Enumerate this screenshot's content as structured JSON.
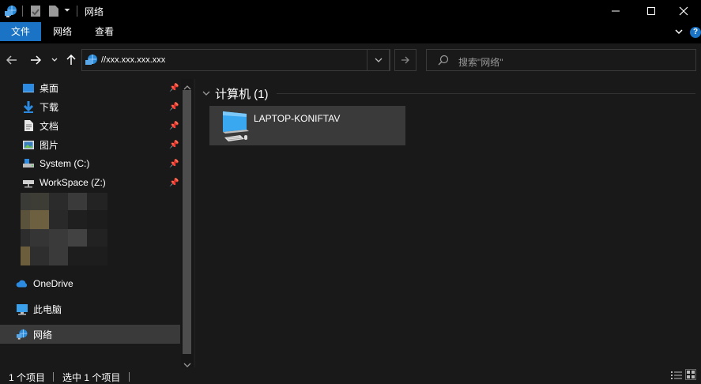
{
  "window": {
    "title": "网络",
    "controls": [
      "minimize",
      "maximize",
      "close"
    ]
  },
  "ribbon": {
    "tabs": [
      {
        "label": "文件",
        "active": true
      },
      {
        "label": "网络",
        "active": false
      },
      {
        "label": "查看",
        "active": false
      }
    ],
    "help": "?"
  },
  "address": {
    "path": "//xxx.xxx.xxx.xxx",
    "search_placeholder": "搜索\"网络\""
  },
  "sidebar": {
    "quick_access": [
      {
        "label": "桌面",
        "icon": "desktop-icon",
        "pinned": true
      },
      {
        "label": "下载",
        "icon": "download-icon",
        "pinned": true
      },
      {
        "label": "文档",
        "icon": "document-icon",
        "pinned": true
      },
      {
        "label": "图片",
        "icon": "pictures-icon",
        "pinned": true
      },
      {
        "label": "System (C:)",
        "icon": "drive-icon",
        "pinned": true
      },
      {
        "label": "WorkSpace (Z:)",
        "icon": "network-drive-icon",
        "pinned": true
      }
    ],
    "locations": [
      {
        "label": "OneDrive",
        "icon": "onedrive-icon"
      },
      {
        "label": "此电脑",
        "icon": "computer-icon"
      },
      {
        "label": "网络",
        "icon": "network-icon",
        "selected": true
      }
    ]
  },
  "content": {
    "group_title": "计算机 (1)",
    "items": [
      {
        "name": "LAPTOP-KONIFTAV",
        "icon": "computer-icon"
      }
    ]
  },
  "status": {
    "item_count": "1 个项目",
    "selected": "选中 1 个项目"
  },
  "colors": {
    "accent": "#1a73c4",
    "background": "#191919",
    "selected_tile": "#3a3a3a"
  }
}
